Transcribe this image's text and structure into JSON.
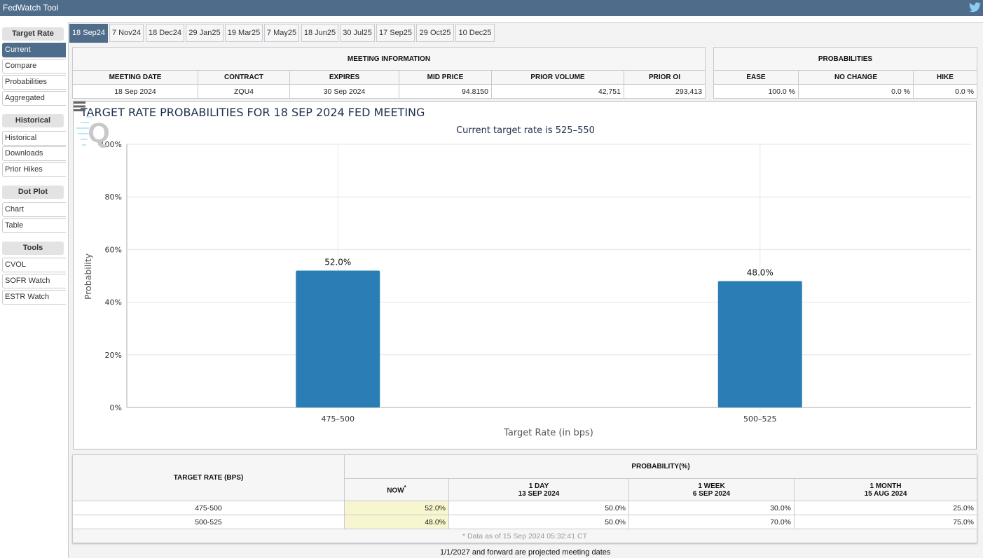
{
  "app": {
    "title": "FedWatch Tool",
    "twitter_icon": "twitter-bird-icon"
  },
  "sidebar": {
    "groups": [
      {
        "label": "Target Rate",
        "items": [
          "Current",
          "Compare",
          "Probabilities",
          "Aggregated"
        ]
      },
      {
        "label": "Historical",
        "items": [
          "Historical",
          "Downloads",
          "Prior Hikes"
        ]
      },
      {
        "label": "Dot Plot",
        "items": [
          "Chart",
          "Table"
        ]
      },
      {
        "label": "Tools",
        "items": [
          "CVOL",
          "SOFR Watch",
          "ESTR Watch"
        ]
      }
    ],
    "active_item": "Current"
  },
  "tabs": [
    "18 Sep24",
    "7 Nov24",
    "18 Dec24",
    "29 Jan25",
    "19 Mar25",
    "7 May25",
    "18 Jun25",
    "30 Jul25",
    "17 Sep25",
    "29 Oct25",
    "10 Dec25"
  ],
  "active_tab": "18 Sep24",
  "meeting_info": {
    "title": "MEETING INFORMATION",
    "headers": [
      "MEETING DATE",
      "CONTRACT",
      "EXPIRES",
      "MID PRICE",
      "PRIOR VOLUME",
      "PRIOR OI"
    ],
    "values": [
      "18 Sep 2024",
      "ZQU4",
      "30 Sep 2024",
      "94.8150",
      "42,751",
      "293,413"
    ]
  },
  "probabilities": {
    "title": "PROBABILITIES",
    "headers": [
      "EASE",
      "NO CHANGE",
      "HIKE"
    ],
    "values": [
      "100.0 %",
      "0.0 %",
      "0.0 %"
    ]
  },
  "chart_data": {
    "type": "bar",
    "title": "TARGET RATE PROBABILITIES FOR 18 SEP 2024 FED MEETING",
    "subtitle": "Current target rate is 525–550",
    "xlabel": "Target Rate (in bps)",
    "ylabel": "Probability",
    "categories": [
      "475–500",
      "500–525"
    ],
    "values": [
      52.0,
      48.0
    ],
    "data_labels": [
      "52.0%",
      "48.0%"
    ],
    "ylim": [
      0,
      100
    ],
    "yticks": [
      0,
      20,
      40,
      60,
      80,
      100
    ],
    "ytick_labels": [
      "0%",
      "20%",
      "40%",
      "60%",
      "80%",
      "100%"
    ],
    "grid": true,
    "bar_color": "#2a7db5",
    "legend": "none"
  },
  "prob_table": {
    "rate_header": "TARGET RATE (BPS)",
    "group_header": "PROBABILITY(%)",
    "columns": [
      {
        "label": "NOW",
        "date": "",
        "marker": "*"
      },
      {
        "label": "1 DAY",
        "date": "13 SEP 2024"
      },
      {
        "label": "1 WEEK",
        "date": "6 SEP 2024"
      },
      {
        "label": "1 MONTH",
        "date": "15 AUG 2024"
      }
    ],
    "rows": [
      {
        "rate": "475-500",
        "values": [
          "52.0%",
          "50.0%",
          "30.0%",
          "25.0%"
        ]
      },
      {
        "rate": "500-525",
        "values": [
          "48.0%",
          "50.0%",
          "70.0%",
          "75.0%"
        ]
      }
    ],
    "footnote": "* Data as of 15 Sep 2024 05:32:41 CT"
  },
  "bottom_note": "1/1/2027 and forward are projected meeting dates"
}
